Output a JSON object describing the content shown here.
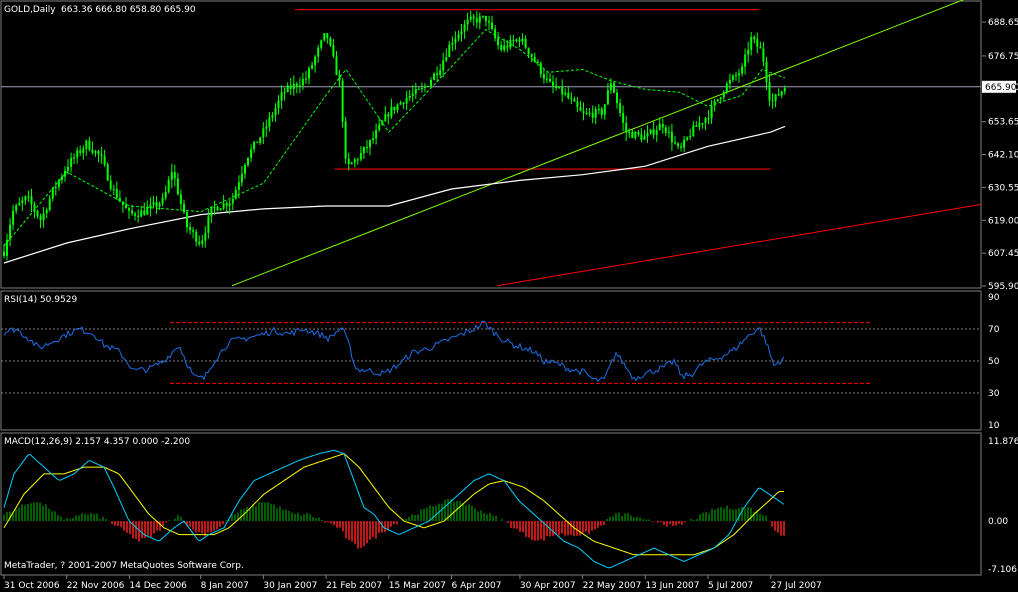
{
  "main": {
    "symbol_label": "GOLD,Daily",
    "ohlc_label": "663.36 666.80 658.80 665.90",
    "current_price_label": "665.90"
  },
  "rsi": {
    "label": "RSI(14) 50.9529"
  },
  "macd": {
    "label": "MACD(12,26,9) 2.157 4.357 0.000 -2.200"
  },
  "copyright": "MetaTrader, ? 2001-2007 MetaQuotes Software Corp.",
  "colors": {
    "background": "#000000",
    "candle": "#00ff00",
    "ma_fast": "#00ff00",
    "ma_slow": "#ffffff",
    "rsi_line": "#1e6ee6",
    "macd_line": "#00d0ff",
    "signal_line": "#ffff00",
    "hist_pos": "#008000",
    "hist_neg": "#ff2020",
    "red_line": "#ff0000",
    "trend_line": "#80ff00",
    "grid": "#808080",
    "bid_line": "#a0a0c0"
  },
  "chart_data": [
    {
      "type": "candlestick",
      "title": "GOLD,Daily",
      "ylim": [
        595.9,
        695.0
      ],
      "y_ticks": [
        "688.65",
        "676.75",
        "665.90",
        "653.65",
        "642.10",
        "630.55",
        "619.00",
        "607.45",
        "595.90"
      ],
      "x_ticks": [
        "31 Oct 2006",
        "22 Nov 2006",
        "14 Dec 2006",
        "8 Jan 2007",
        "30 Jan 2007",
        "21 Feb 2007",
        "15 Mar 2007",
        "6 Apr 2007",
        "30 Apr 2007",
        "22 May 2007",
        "13 Jun 2007",
        "5 Jul 2007",
        "27 Jul 2007"
      ],
      "close_path": [
        [
          "31 Oct 2006",
          608
        ],
        [
          "3 Nov 2006",
          622
        ],
        [
          "8 Nov 2006",
          627
        ],
        [
          "13 Nov 2006",
          619
        ],
        [
          "17 Nov 2006",
          629
        ],
        [
          "22 Nov 2006",
          638
        ],
        [
          "29 Nov 2006",
          646
        ],
        [
          "4 Dec 2006",
          641
        ],
        [
          "8 Dec 2006",
          630
        ],
        [
          "14 Dec 2006",
          621
        ],
        [
          "19 Dec 2006",
          622
        ],
        [
          "26 Dec 2006",
          626
        ],
        [
          "29 Dec 2006",
          637
        ],
        [
          "3 Jan 2007",
          617
        ],
        [
          "8 Jan 2007",
          611
        ],
        [
          "12 Jan 2007",
          623
        ],
        [
          "19 Jan 2007",
          626
        ],
        [
          "24 Jan 2007",
          641
        ],
        [
          "30 Jan 2007",
          650
        ],
        [
          "6 Feb 2007",
          664
        ],
        [
          "14 Feb 2007",
          669
        ],
        [
          "21 Feb 2007",
          685
        ],
        [
          "26 Feb 2007",
          666
        ],
        [
          "28 Feb 2007",
          637
        ],
        [
          "5 Mar 2007",
          642
        ],
        [
          "9 Mar 2007",
          647
        ],
        [
          "15 Mar 2007",
          657
        ],
        [
          "21 Mar 2007",
          662
        ],
        [
          "27 Mar 2007",
          665
        ],
        [
          "2 Apr 2007",
          673
        ],
        [
          "6 Apr 2007",
          682
        ],
        [
          "12 Apr 2007",
          689
        ],
        [
          "18 Apr 2007",
          690
        ],
        [
          "23 Apr 2007",
          679
        ],
        [
          "30 Apr 2007",
          683
        ],
        [
          "4 May 2007",
          677
        ],
        [
          "10 May 2007",
          667
        ],
        [
          "16 May 2007",
          663
        ],
        [
          "22 May 2007",
          656
        ],
        [
          "29 May 2007",
          657
        ],
        [
          "1 Jun 2007",
          668
        ],
        [
          "6 Jun 2007",
          650
        ],
        [
          "13 Jun 2007",
          648
        ],
        [
          "19 Jun 2007",
          653
        ],
        [
          "25 Jun 2007",
          643
        ],
        [
          "29 Jun 2007",
          650
        ],
        [
          "5 Jul 2007",
          656
        ],
        [
          "11 Jul 2007",
          666
        ],
        [
          "17 Jul 2007",
          672
        ],
        [
          "20 Jul 2007",
          683
        ],
        [
          "24 Jul 2007",
          678
        ],
        [
          "27 Jul 2007",
          660
        ],
        [
          "1 Aug 2007",
          665.9
        ]
      ],
      "ma_fast_path": [
        [
          "31 Oct 2006",
          610
        ],
        [
          "22 Nov 2006",
          636
        ],
        [
          "14 Dec 2006",
          624
        ],
        [
          "8 Jan 2007",
          622
        ],
        [
          "30 Jan 2007",
          632
        ],
        [
          "21 Feb 2007",
          663
        ],
        [
          "28 Feb 2007",
          672
        ],
        [
          "15 Mar 2007",
          650
        ],
        [
          "6 Apr 2007",
          673
        ],
        [
          "18 Apr 2007",
          686
        ],
        [
          "30 Apr 2007",
          679
        ],
        [
          "10 May 2007",
          671
        ],
        [
          "22 May 2007",
          672
        ],
        [
          "1 Jun 2007",
          668
        ],
        [
          "13 Jun 2007",
          665
        ],
        [
          "25 Jun 2007",
          664
        ],
        [
          "5 Jul 2007",
          659
        ],
        [
          "17 Jul 2007",
          663
        ],
        [
          "24 Jul 2007",
          672
        ],
        [
          "1 Aug 2007",
          669
        ]
      ],
      "ma_slow_path": [
        [
          "31 Oct 2006",
          604
        ],
        [
          "22 Nov 2006",
          611
        ],
        [
          "14 Dec 2006",
          616
        ],
        [
          "8 Jan 2007",
          621
        ],
        [
          "30 Jan 2007",
          623
        ],
        [
          "21 Feb 2007",
          624
        ],
        [
          "15 Mar 2007",
          624
        ],
        [
          "6 Apr 2007",
          630
        ],
        [
          "30 Apr 2007",
          633
        ],
        [
          "22 May 2007",
          635
        ],
        [
          "13 Jun 2007",
          638
        ],
        [
          "5 Jul 2007",
          645
        ],
        [
          "27 Jul 2007",
          650
        ],
        [
          "1 Aug 2007",
          652
        ]
      ],
      "lines": [
        {
          "name": "top resistance",
          "color": "red",
          "from": [
            "10 Feb 2007",
            693
          ],
          "to": [
            "23 Jul 2007",
            693
          ]
        },
        {
          "name": "support",
          "color": "red",
          "from": [
            "24 Feb 2007",
            637
          ],
          "to": [
            "27 Jul 2007",
            637
          ]
        },
        {
          "name": "trend line",
          "color": "green",
          "from": [
            "19 Jan 2007",
            596
          ],
          "to": [
            "1 Aug 2007",
            672
          ]
        },
        {
          "name": "lower channel",
          "color": "red",
          "from": [
            "22 Apr 2007",
            596
          ],
          "to": [
            "1 Aug 2007",
            613
          ]
        }
      ],
      "bid_price": 665.9
    },
    {
      "type": "line",
      "title": "RSI(14) 50.9529",
      "ylim": [
        10,
        90
      ],
      "y_ticks": [
        "90",
        "70",
        "50",
        "30",
        "10"
      ],
      "levels": [
        70,
        50,
        30
      ],
      "path": [
        [
          0,
          68
        ],
        [
          12,
          70
        ],
        [
          25,
          64
        ],
        [
          35,
          58
        ],
        [
          45,
          61
        ],
        [
          60,
          66
        ],
        [
          75,
          70
        ],
        [
          90,
          67
        ],
        [
          100,
          60
        ],
        [
          115,
          56
        ],
        [
          130,
          44
        ],
        [
          145,
          45
        ],
        [
          160,
          50
        ],
        [
          175,
          60
        ],
        [
          182,
          50
        ],
        [
          190,
          40
        ],
        [
          200,
          39
        ],
        [
          210,
          50
        ],
        [
          225,
          62
        ],
        [
          240,
          64
        ],
        [
          255,
          66
        ],
        [
          270,
          69
        ],
        [
          285,
          67
        ],
        [
          300,
          70
        ],
        [
          315,
          67
        ],
        [
          325,
          64
        ],
        [
          338,
          71
        ],
        [
          345,
          60
        ],
        [
          352,
          45
        ],
        [
          365,
          44
        ],
        [
          380,
          42
        ],
        [
          395,
          48
        ],
        [
          408,
          55
        ],
        [
          425,
          58
        ],
        [
          440,
          62
        ],
        [
          455,
          66
        ],
        [
          470,
          70
        ],
        [
          480,
          74
        ],
        [
          490,
          68
        ],
        [
          500,
          63
        ],
        [
          510,
          60
        ],
        [
          520,
          58
        ],
        [
          530,
          56
        ],
        [
          540,
          50
        ],
        [
          555,
          48
        ],
        [
          565,
          45
        ],
        [
          580,
          43
        ],
        [
          590,
          38
        ],
        [
          600,
          38
        ],
        [
          612,
          55
        ],
        [
          620,
          48
        ],
        [
          630,
          39
        ],
        [
          640,
          42
        ],
        [
          650,
          44
        ],
        [
          660,
          46
        ],
        [
          670,
          50
        ],
        [
          678,
          40
        ],
        [
          688,
          42
        ],
        [
          700,
          49
        ],
        [
          715,
          52
        ],
        [
          730,
          57
        ],
        [
          745,
          66
        ],
        [
          755,
          71
        ],
        [
          762,
          62
        ],
        [
          770,
          47
        ],
        [
          778,
          51
        ],
        [
          783,
          50.95
        ]
      ],
      "dashed_lines": [
        {
          "color": "red",
          "value": 74,
          "from": 170,
          "to": 870
        },
        {
          "color": "red",
          "value": 36,
          "from": 170,
          "to": 870
        }
      ]
    },
    {
      "type": "line",
      "title": "MACD(12,26,9) 2.157 4.357 0.000 -2.200",
      "ylim": [
        -7.106,
        11.876
      ],
      "y_ticks": [
        "11.876",
        "0.00",
        "-7.106"
      ],
      "macd_path": [
        [
          0,
          2
        ],
        [
          10,
          7
        ],
        [
          25,
          10
        ],
        [
          40,
          8
        ],
        [
          55,
          6
        ],
        [
          70,
          7
        ],
        [
          85,
          9
        ],
        [
          100,
          8
        ],
        [
          110,
          5
        ],
        [
          125,
          0
        ],
        [
          140,
          -2
        ],
        [
          155,
          -3
        ],
        [
          170,
          -1
        ],
        [
          180,
          0
        ],
        [
          195,
          -3
        ],
        [
          205,
          -2
        ],
        [
          220,
          -1
        ],
        [
          235,
          3
        ],
        [
          250,
          6
        ],
        [
          265,
          7
        ],
        [
          280,
          8
        ],
        [
          295,
          9
        ],
        [
          315,
          10
        ],
        [
          330,
          10.5
        ],
        [
          340,
          10
        ],
        [
          350,
          6
        ],
        [
          360,
          2
        ],
        [
          370,
          1
        ],
        [
          380,
          -1
        ],
        [
          395,
          -2
        ],
        [
          410,
          -1
        ],
        [
          425,
          0
        ],
        [
          440,
          2
        ],
        [
          455,
          4
        ],
        [
          470,
          6
        ],
        [
          485,
          7
        ],
        [
          500,
          6
        ],
        [
          515,
          3
        ],
        [
          530,
          1
        ],
        [
          545,
          -1
        ],
        [
          560,
          -3
        ],
        [
          575,
          -4
        ],
        [
          590,
          -6
        ],
        [
          605,
          -7
        ],
        [
          620,
          -6
        ],
        [
          635,
          -5
        ],
        [
          650,
          -4
        ],
        [
          665,
          -5
        ],
        [
          680,
          -6
        ],
        [
          695,
          -5
        ],
        [
          710,
          -4
        ],
        [
          725,
          -2
        ],
        [
          740,
          2
        ],
        [
          755,
          5
        ],
        [
          765,
          4
        ],
        [
          775,
          3
        ],
        [
          783,
          2.157
        ]
      ],
      "signal_path": [
        [
          0,
          -1
        ],
        [
          20,
          4
        ],
        [
          40,
          7
        ],
        [
          60,
          7
        ],
        [
          80,
          8
        ],
        [
          100,
          8
        ],
        [
          115,
          7
        ],
        [
          130,
          4
        ],
        [
          145,
          1
        ],
        [
          160,
          -1
        ],
        [
          175,
          -2
        ],
        [
          195,
          -2
        ],
        [
          210,
          -2
        ],
        [
          225,
          -1
        ],
        [
          240,
          1
        ],
        [
          260,
          4
        ],
        [
          280,
          6
        ],
        [
          300,
          8
        ],
        [
          320,
          9
        ],
        [
          340,
          10
        ],
        [
          355,
          8
        ],
        [
          370,
          5
        ],
        [
          385,
          2
        ],
        [
          400,
          0
        ],
        [
          420,
          -1
        ],
        [
          440,
          0
        ],
        [
          455,
          2
        ],
        [
          470,
          4
        ],
        [
          485,
          5.5
        ],
        [
          500,
          6
        ],
        [
          520,
          5
        ],
        [
          540,
          3
        ],
        [
          555,
          1
        ],
        [
          570,
          -1
        ],
        [
          590,
          -3
        ],
        [
          610,
          -4
        ],
        [
          630,
          -5
        ],
        [
          650,
          -5
        ],
        [
          670,
          -5
        ],
        [
          690,
          -5
        ],
        [
          710,
          -4
        ],
        [
          730,
          -2
        ],
        [
          750,
          1
        ],
        [
          765,
          3
        ],
        [
          775,
          4.4
        ],
        [
          783,
          4.357
        ]
      ],
      "hist_path": [
        [
          0,
          1
        ],
        [
          15,
          2
        ],
        [
          30,
          3
        ],
        [
          45,
          2
        ],
        [
          60,
          0
        ],
        [
          75,
          1
        ],
        [
          90,
          1
        ],
        [
          105,
          0
        ],
        [
          115,
          -1
        ],
        [
          125,
          -2
        ],
        [
          135,
          -3
        ],
        [
          150,
          -2
        ],
        [
          165,
          0
        ],
        [
          175,
          1
        ],
        [
          185,
          -1
        ],
        [
          200,
          -2
        ],
        [
          215,
          -1
        ],
        [
          230,
          1
        ],
        [
          245,
          2
        ],
        [
          260,
          3
        ],
        [
          275,
          2
        ],
        [
          290,
          1
        ],
        [
          305,
          1
        ],
        [
          320,
          0
        ],
        [
          335,
          -1
        ],
        [
          345,
          -3
        ],
        [
          355,
          -4
        ],
        [
          365,
          -3
        ],
        [
          375,
          -2
        ],
        [
          385,
          -1
        ],
        [
          395,
          0
        ],
        [
          410,
          1
        ],
        [
          425,
          2
        ],
        [
          440,
          3
        ],
        [
          455,
          3
        ],
        [
          470,
          2
        ],
        [
          485,
          1
        ],
        [
          500,
          0
        ],
        [
          510,
          -1
        ],
        [
          520,
          -2
        ],
        [
          535,
          -3
        ],
        [
          550,
          -2
        ],
        [
          565,
          -2
        ],
        [
          580,
          -2
        ],
        [
          595,
          -1
        ],
        [
          610,
          1
        ],
        [
          625,
          1
        ],
        [
          640,
          0
        ],
        [
          655,
          0
        ],
        [
          670,
          -1
        ],
        [
          685,
          0
        ],
        [
          700,
          1
        ],
        [
          715,
          2
        ],
        [
          730,
          2
        ],
        [
          745,
          2
        ],
        [
          760,
          1
        ],
        [
          770,
          -1
        ],
        [
          777,
          -2
        ],
        [
          783,
          -2.2
        ]
      ]
    }
  ]
}
